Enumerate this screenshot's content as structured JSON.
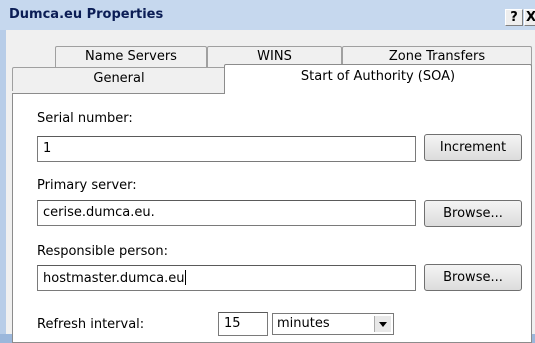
{
  "window": {
    "title": "Dumca.eu Properties",
    "help_label": "?",
    "close_label": "X"
  },
  "tabs": {
    "row1": [
      {
        "label": "Name Servers"
      },
      {
        "label": "WINS"
      },
      {
        "label": "Zone Transfers"
      }
    ],
    "row2": [
      {
        "label": "General"
      },
      {
        "label": "Start of Authority (SOA)",
        "active": true
      }
    ]
  },
  "soa": {
    "serial_label": "Serial number:",
    "serial_value": "1",
    "increment_label": "Increment",
    "primary_label": "Primary server:",
    "primary_value": "cerise.dumca.eu.",
    "primary_browse_label": "Browse...",
    "responsible_label": "Responsible person:",
    "responsible_value": "hostmaster.dumca.eu",
    "responsible_browse_label": "Browse...",
    "refresh_label": "Refresh interval:",
    "refresh_value": "15",
    "refresh_unit": "minutes"
  },
  "colors": {
    "titlebar": "#c6d8ee",
    "title_text": "#0b1d55",
    "panel": "#ffffff",
    "dialog": "#f0f0f0"
  }
}
